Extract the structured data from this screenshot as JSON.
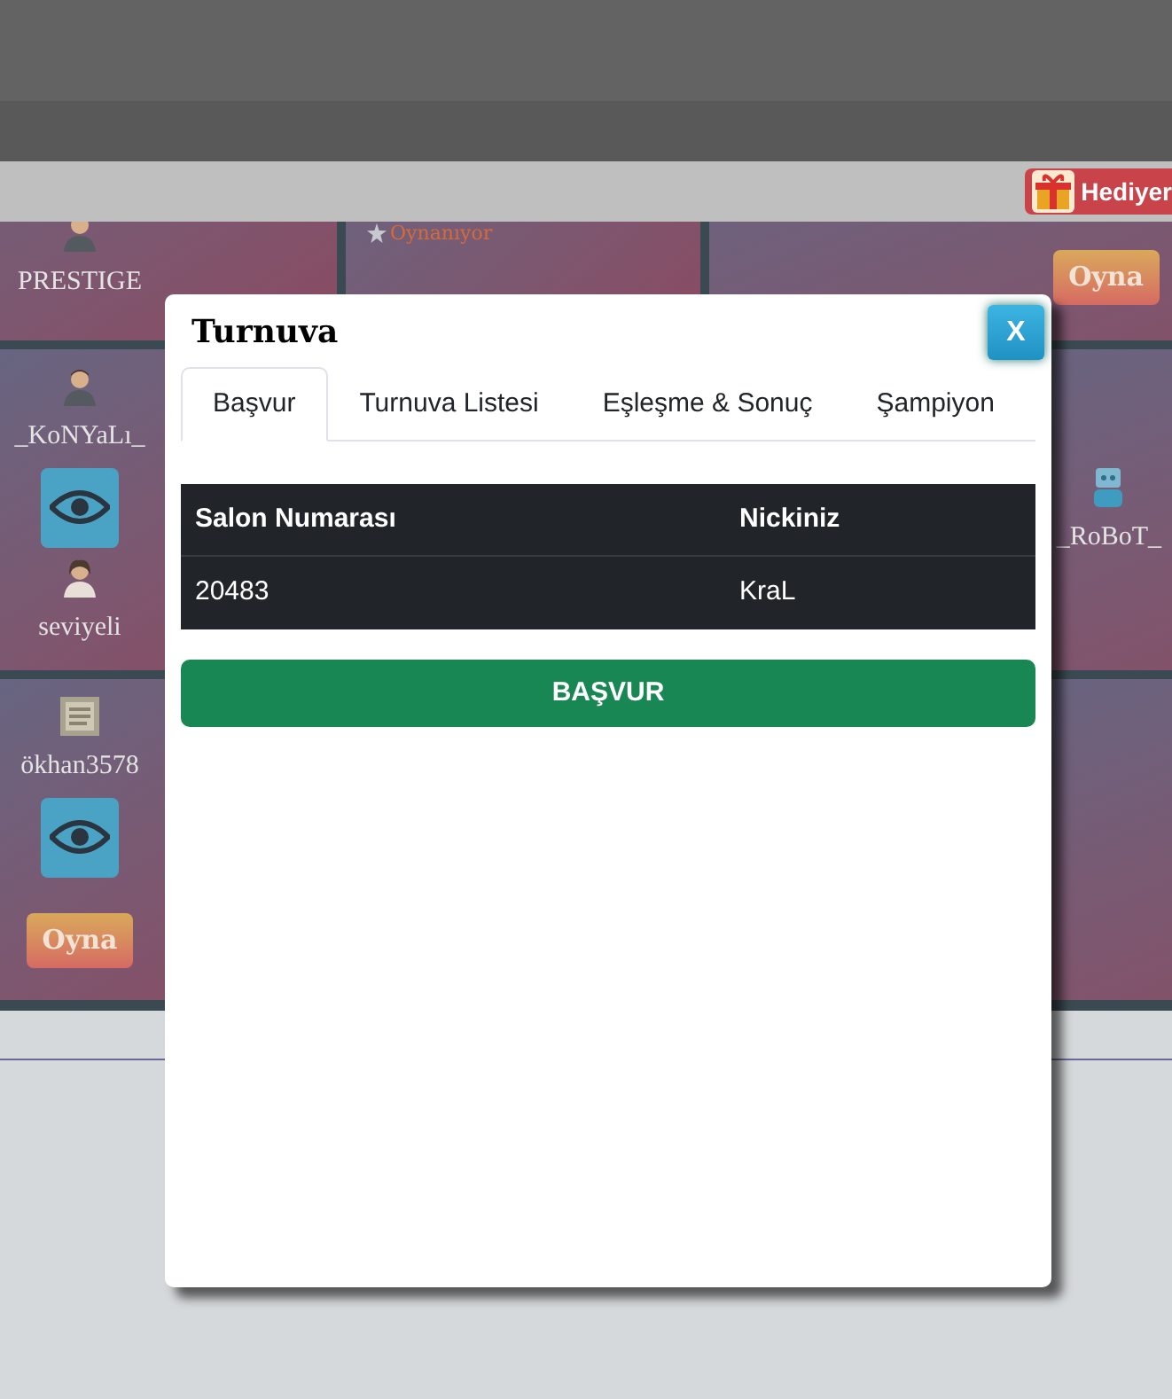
{
  "top_bar": {
    "gift_button": "Hediyer"
  },
  "tiles": [
    {
      "kind": "table",
      "items": [
        {
          "kind": "player",
          "avatar": {
            "kind": "man"
          },
          "name": "PRESTIGE"
        }
      ]
    },
    {
      "kind": "table",
      "items": [
        {
          "kind": "status",
          "text": "Oynanıyor"
        }
      ]
    },
    {
      "kind": "table",
      "items": [
        {
          "kind": "play",
          "text": "Oyna"
        }
      ]
    },
    {
      "kind": "table",
      "items": [
        {
          "kind": "player",
          "avatar": {
            "kind": "man"
          },
          "name": "_KoNYaLı_"
        },
        {
          "kind": "watch"
        },
        {
          "kind": "player",
          "avatar": {
            "kind": "woman"
          },
          "name": "seviyeli"
        }
      ]
    },
    {
      "kind": "table",
      "items": [
        {
          "kind": "player",
          "avatar": {
            "kind": "robot"
          },
          "name": "_RoBoT_"
        }
      ]
    },
    {
      "kind": "table",
      "items": [
        {
          "kind": "player",
          "name": "ökhan3578"
        },
        {
          "kind": "watch"
        },
        {
          "kind": "play",
          "text": "Oyna"
        }
      ]
    },
    {
      "kind": "table"
    }
  ],
  "modal": {
    "title": "Turnuva",
    "close": "X",
    "tabs": [
      {
        "label": "Başvur",
        "selected": true
      },
      {
        "label": "Turnuva Listesi",
        "selected": false
      },
      {
        "label": "Eşleşme & Sonuç",
        "selected": false
      },
      {
        "label": "Şampiyon",
        "selected": false
      }
    ],
    "table": {
      "columns": [
        "Salon Numarası",
        "Nickiniz"
      ],
      "rows": [
        [
          "20483",
          "KraL"
        ]
      ]
    },
    "apply_button": "BAŞVUR"
  }
}
